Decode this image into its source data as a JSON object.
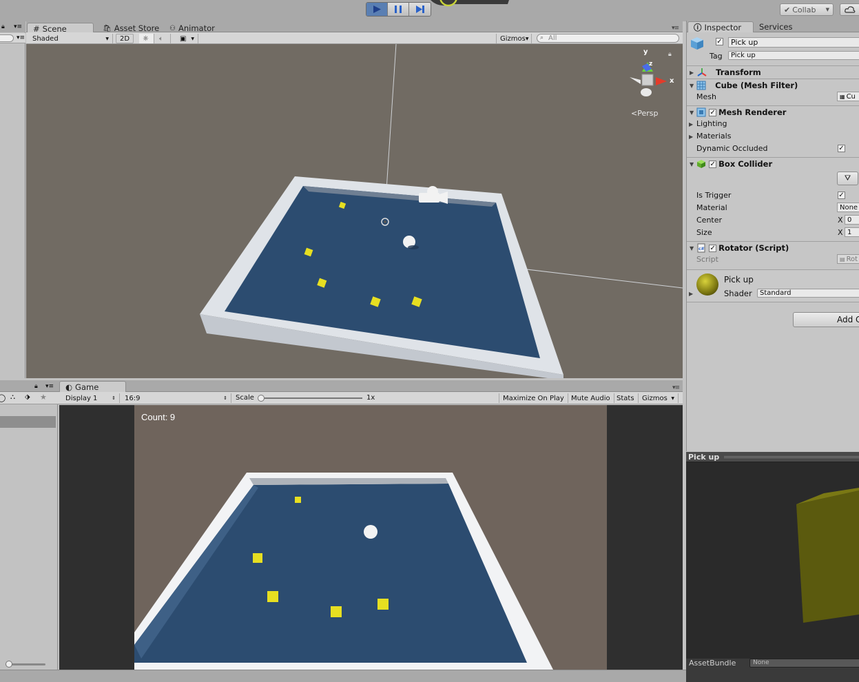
{
  "toolbar": {
    "play_state": "playing",
    "collab_label": "Collab"
  },
  "scene_panel": {
    "tabs": [
      {
        "label": "Scene",
        "icon": "hash-icon"
      },
      {
        "label": "Asset Store",
        "icon": "store-icon"
      },
      {
        "label": "Animator",
        "icon": "animator-icon"
      }
    ],
    "shading_mode": "Shaded",
    "mode_2d": "2D",
    "gizmos_label": "Gizmos",
    "search_placeholder": "All",
    "persp_label": "Persp",
    "axis_y": "y",
    "axis_x": "x",
    "axis_z": "z"
  },
  "game_panel": {
    "tab_label": "Game",
    "display": "Display 1",
    "aspect": "16:9",
    "scale_label": "Scale",
    "scale_value": "1x",
    "scale_fraction": 0.0,
    "maximize_label": "Maximize On Play",
    "mute_label": "Mute Audio",
    "stats_label": "Stats",
    "gizmos_label": "Gizmos",
    "count_text": "Count: 9"
  },
  "inspector": {
    "tabs": [
      "Inspector",
      "Services"
    ],
    "object_name": "Pick up",
    "tag_label": "Tag",
    "tag_value": "Pick up",
    "components": {
      "transform": "Transform",
      "mesh_filter": "Cube (Mesh Filter)",
      "mesh_label": "Mesh",
      "mesh_value": "Cu",
      "mesh_renderer": "Mesh Renderer",
      "lighting": "Lighting",
      "materials": "Materials",
      "dynamic_occluded": "Dynamic Occluded",
      "box_collider": "Box Collider",
      "is_trigger": "Is Trigger",
      "material_label": "Material",
      "material_value": "None",
      "center_label": "Center",
      "center_x_label": "X",
      "center_x_value": "0",
      "size_label": "Size",
      "size_x_label": "X",
      "size_x_value": "1",
      "rotator": "Rotator (Script)",
      "script_label": "Script",
      "script_value": "Rot"
    },
    "material": {
      "name": "Pick up",
      "shader_label": "Shader",
      "shader_value": "Standard"
    },
    "add_component_label": "Add C"
  },
  "preview": {
    "title": "Pick up",
    "assetbundle_label": "AssetBundle",
    "assetbundle_value": "None"
  },
  "colors": {
    "floor": "#2a4c72",
    "wall": "#e8eaee",
    "pickup": "#e8e021",
    "scene_bg": "#716b63",
    "play_active": "#5a7fb3"
  }
}
